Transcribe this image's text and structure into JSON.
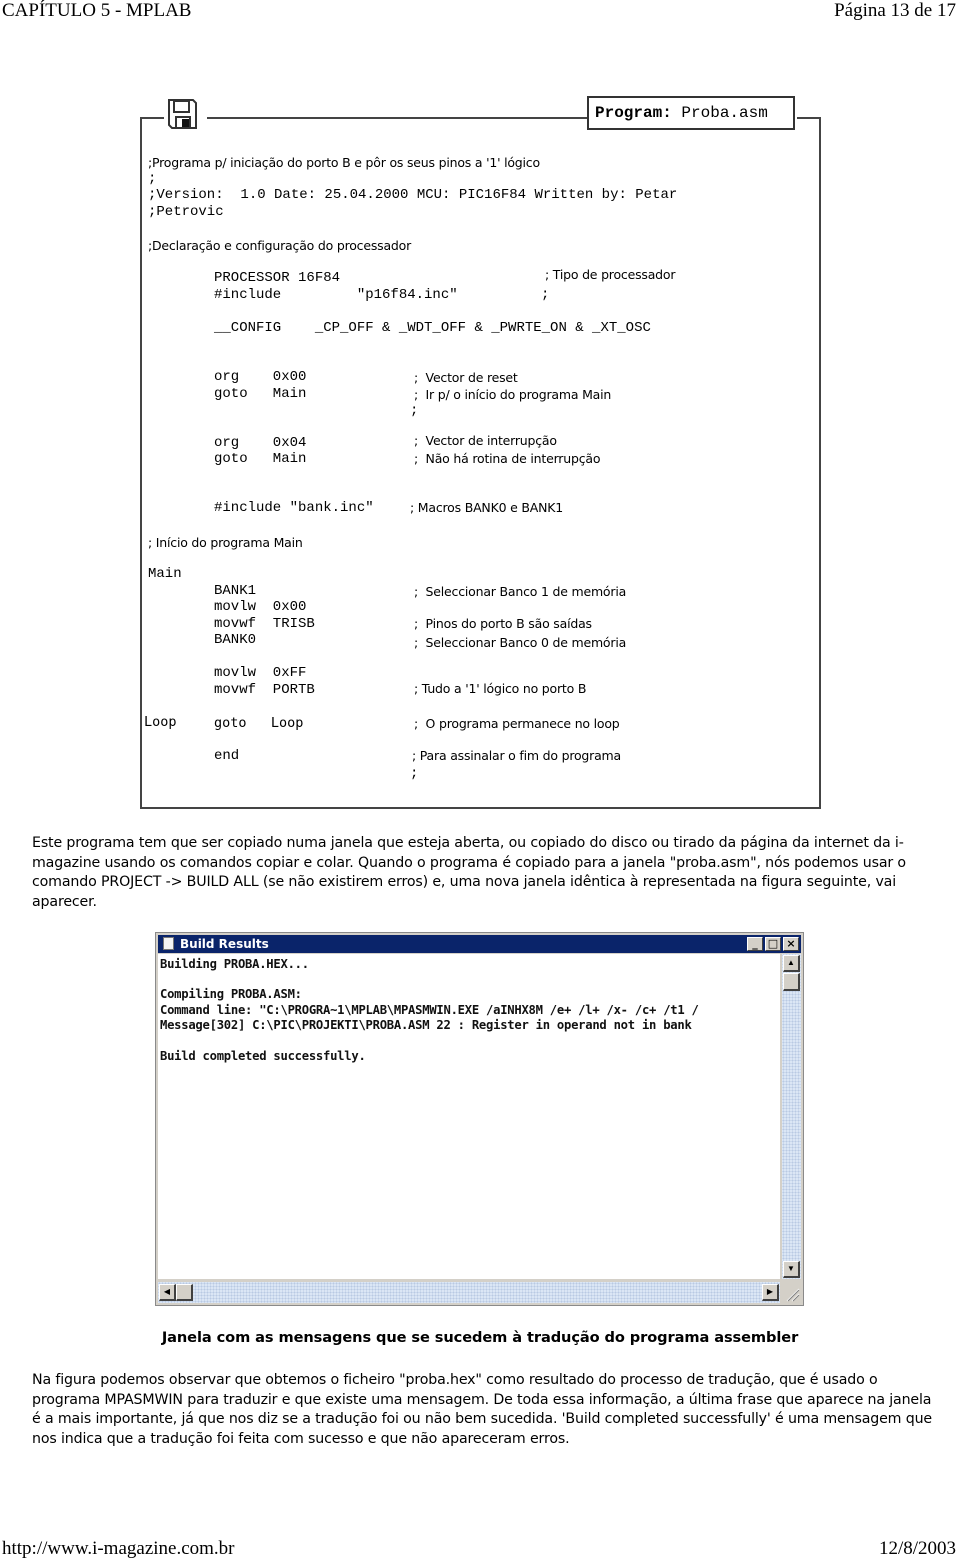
{
  "header": {
    "left": "CAPÍTULO 5 - MPLAB",
    "right": "Página 13 de 17"
  },
  "footer": {
    "left": "http://www.i-magazine.com.br",
    "right": "12/8/2003"
  },
  "program_figure": {
    "icon": "floppy-disk-icon",
    "title_label": "Program:",
    "title_file": "Proba.asm",
    "lines": {
      "c1": ";Programa p/ iniciação do porto B e pôr os seus pinos a '1' lógico",
      "c2": ";",
      "c3": ";Version:  1.0 Date: 25.04.2000 MCU: PIC16F84 Written by: Petar",
      "c4": ";Petrovic",
      "c5": ";Declaração e configuração do processador",
      "processor_code": "PROCESSOR 16F84",
      "processor_comment": "; Tipo de processador",
      "include_code": "#include         \"p16f84.inc\"",
      "include_comment": ";",
      "config_code": "__CONFIG    _CP_OFF & _WDT_OFF & _PWRTE_ON & _XT_OSC",
      "org1_code": "org    0x00",
      "org1_comment": ";  Vector de reset",
      "goto1_code": "goto   Main",
      "goto1_comment": ";  Ir p/ o início do programa Main",
      "semi1": ";",
      "org2_code": "org    0x04",
      "org2_comment": ";  Vector de interrupção",
      "goto2_code": "goto   Main",
      "goto2_comment": ";  Não há rotina de interrupção",
      "bankinc_code": "#include \"bank.inc\"",
      "bankinc_comment": "; Macros BANK0 e BANK1",
      "main_comment": "; Início do programa Main",
      "main_label": "Main",
      "bank1_code": "BANK1",
      "bank1_comment": ";  Seleccionar Banco 1 de memória",
      "movlw1_code": "movlw  0x00",
      "movwf1_code": "movwf  TRISB",
      "movwf1_comment": ";  Pinos do porto B são saídas",
      "bank0_code": "BANK0",
      "bank0_comment": ";  Seleccionar Banco 0 de memória",
      "movlw2_code": "movlw  0xFF",
      "movwf2_code": "movwf  PORTB",
      "movwf2_comment": "; Tudo a '1' lógico no porto B",
      "loop_label": "Loop",
      "loop_code": "goto   Loop",
      "loop_comment": ";  O programa permanece no loop",
      "end_code": "end",
      "end_comment": "; Para assinalar o fim do programa",
      "semi2": ";"
    }
  },
  "paragraph1": "Este programa tem que ser copiado numa janela que esteja aberta, ou copiado do disco ou tirado da página da internet da i-magazine usando os comandos copiar e colar. Quando o programa é copiado para a janela \"proba.asm\", nós podemos usar o comando PROJECT -> BUILD ALL (se não existirem erros) e, uma nova janela idêntica à representada na figura seguinte, vai aparecer.",
  "build_window": {
    "title": "Build Results",
    "title_icon": "document-icon",
    "buttons": {
      "minimize": "_",
      "maximize": "□",
      "close": "×"
    },
    "lines": [
      "Building PROBA.HEX...",
      "",
      "Compiling PROBA.ASM:",
      "Command line: \"C:\\PROGRA~1\\MPLAB\\MPASMWIN.EXE /aINHX8M /e+ /l+ /x- /c+ /t1 /",
      "Message[302] C:\\PIC\\PROJEKTI\\PROBA.ASM 22 : Register in operand not in bank",
      "",
      "Build completed successfully."
    ],
    "scroll_arrows": {
      "up": "▲",
      "down": "▼",
      "left": "◀",
      "right": "▶"
    }
  },
  "caption": "Janela com as mensagens que se sucedem à tradução do programa assembler",
  "paragraph2": "Na figura podemos observar que obtemos o ficheiro \"proba.hex\" como resultado do processo de tradução, que é usado o programa MPASMWIN para traduzir e que existe uma mensagem. De toda essa informação, a última frase que aparece na janela é a mais importante, já que nos diz se a tradução foi ou não bem sucedida. 'Build completed successfully' é uma mensagem que nos indica que a tradução foi feita com sucesso e que não apareceram erros."
}
